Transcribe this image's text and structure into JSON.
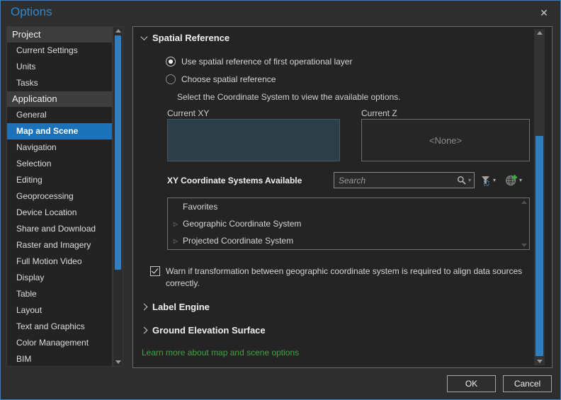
{
  "window": {
    "title": "Options",
    "close_glyph": "✕"
  },
  "sidebar": {
    "sections": [
      {
        "header": "Project",
        "items": [
          {
            "label": "Current Settings"
          },
          {
            "label": "Units"
          },
          {
            "label": "Tasks"
          }
        ]
      },
      {
        "header": "Application",
        "items": [
          {
            "label": "General"
          },
          {
            "label": "Map and Scene",
            "selected": true
          },
          {
            "label": "Navigation"
          },
          {
            "label": "Selection"
          },
          {
            "label": "Editing"
          },
          {
            "label": "Geoprocessing"
          },
          {
            "label": "Device Location"
          },
          {
            "label": "Share and Download"
          },
          {
            "label": "Raster and Imagery"
          },
          {
            "label": "Full Motion Video"
          },
          {
            "label": "Display"
          },
          {
            "label": "Table"
          },
          {
            "label": "Layout"
          },
          {
            "label": "Text and Graphics"
          },
          {
            "label": "Color Management"
          },
          {
            "label": "BIM"
          }
        ]
      }
    ]
  },
  "spatial_reference": {
    "title": "Spatial Reference",
    "radio_use_first_layer": {
      "label": "Use spatial reference of first operational layer",
      "selected": true
    },
    "radio_choose": {
      "label": "Choose spatial reference",
      "selected": false
    },
    "hint": "Select the Coordinate System to view the available options.",
    "current_xy": {
      "label": "Current XY",
      "value": ""
    },
    "current_z": {
      "label": "Current Z",
      "value": "<None>"
    },
    "xy_systems": {
      "label": "XY Coordinate Systems Available",
      "search_placeholder": "Search",
      "expand_glyph": "▷",
      "caret_glyph": "▾",
      "list": [
        {
          "label": "Favorites",
          "expandable": false
        },
        {
          "label": "Geographic Coordinate System",
          "expandable": true
        },
        {
          "label": "Projected Coordinate System",
          "expandable": true
        }
      ]
    },
    "warn_checkbox": {
      "label": "Warn if transformation between geographic coordinate system is required to align data sources correctly.",
      "checked": true
    }
  },
  "label_engine": {
    "title": "Label Engine"
  },
  "ground_elevation": {
    "title": "Ground Elevation Surface"
  },
  "link": "Learn more about map and scene options",
  "footer": {
    "ok": "OK",
    "cancel": "Cancel"
  },
  "colors": {
    "accent_blue": "#2f87cd",
    "selection_blue": "#1b72b9",
    "scrollbar_blue": "#2d7fc2",
    "link_green": "#42a142",
    "current_xy_fill": "#2d3e48",
    "window_border": "#3a7ebd"
  }
}
